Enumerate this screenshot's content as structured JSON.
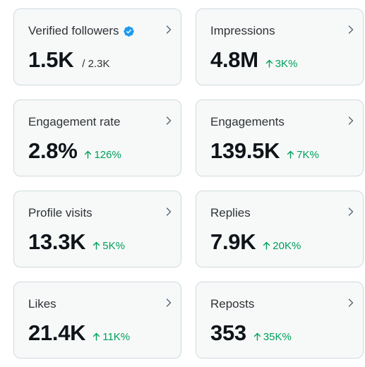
{
  "colors": {
    "card_background": "#f7f9f9",
    "card_border": "#cfd9de",
    "text_primary": "#0f1419",
    "change_positive": "#00a05a",
    "verified_badge": "#1d9bf0"
  },
  "cards": [
    {
      "title": "Verified followers",
      "value": "1.5K",
      "sub": "/ 2.3K",
      "verified_icon": "verified-badge-icon",
      "chevron_icon": "chevron-right-icon"
    },
    {
      "title": "Impressions",
      "value": "4.8M",
      "change": "3K%",
      "change_icon": "arrow-up-icon",
      "chevron_icon": "chevron-right-icon"
    },
    {
      "title": "Engagement rate",
      "value": "2.8%",
      "change": "126%",
      "change_icon": "arrow-up-icon",
      "chevron_icon": "chevron-right-icon"
    },
    {
      "title": "Engagements",
      "value": "139.5K",
      "change": "7K%",
      "change_icon": "arrow-up-icon",
      "chevron_icon": "chevron-right-icon"
    },
    {
      "title": "Profile visits",
      "value": "13.3K",
      "change": "5K%",
      "change_icon": "arrow-up-icon",
      "chevron_icon": "chevron-right-icon"
    },
    {
      "title": "Replies",
      "value": "7.9K",
      "change": "20K%",
      "change_icon": "arrow-up-icon",
      "chevron_icon": "chevron-right-icon"
    },
    {
      "title": "Likes",
      "value": "21.4K",
      "change": "11K%",
      "change_icon": "arrow-up-icon",
      "chevron_icon": "chevron-right-icon"
    },
    {
      "title": "Reposts",
      "value": "353",
      "change": "35K%",
      "change_icon": "arrow-up-icon",
      "chevron_icon": "chevron-right-icon"
    }
  ]
}
